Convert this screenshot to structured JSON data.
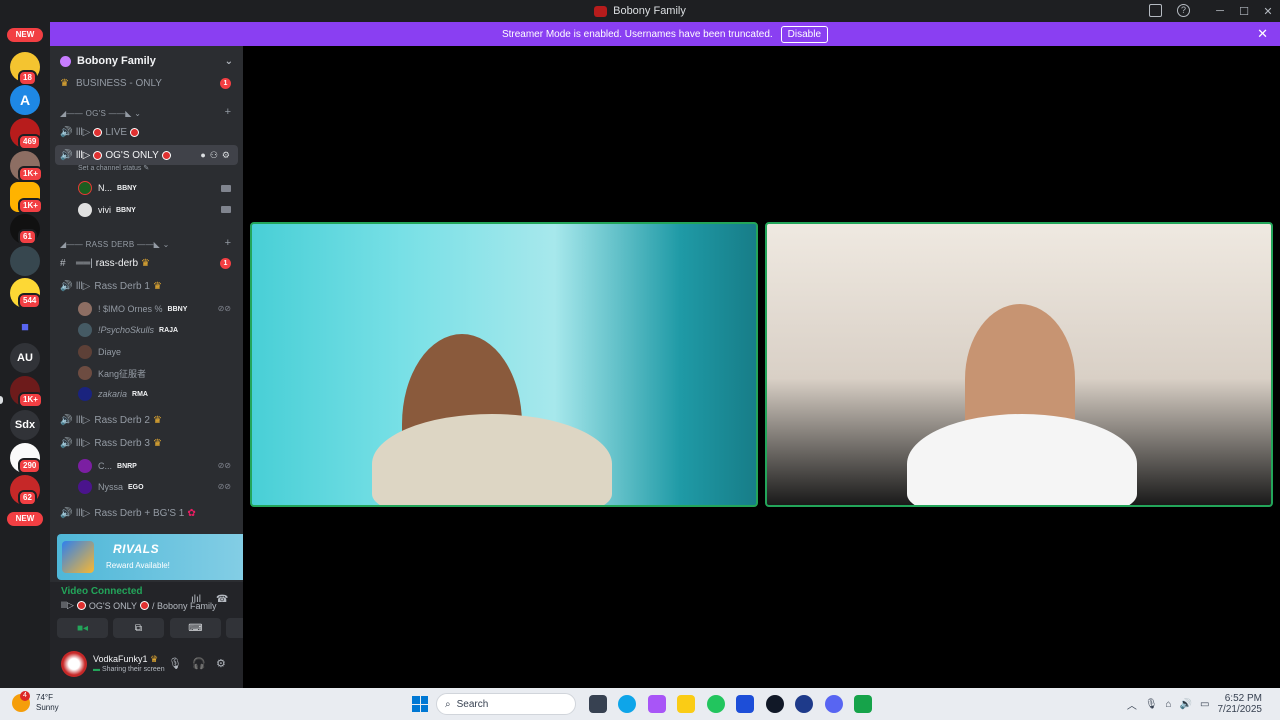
{
  "window": {
    "title": "Bobony Family"
  },
  "banner": {
    "text": "Streamer Mode is enabled. Usernames have been truncated.",
    "button": "Disable"
  },
  "servers": {
    "new_top": "NEW",
    "new_bottom": "NEW",
    "badges": [
      "18",
      "469",
      "1K+",
      "1K+",
      "61",
      "544",
      "1K+",
      "290",
      "62"
    ],
    "text_icons": [
      "AU",
      "Sdx"
    ]
  },
  "guild": {
    "name": "Bobony Family"
  },
  "channels": {
    "business": "BUSINESS - ONLY",
    "business_mentions": "1",
    "cat_ogs": "OG'S",
    "live": "LIVE",
    "ogs_only": "OG'S ONLY",
    "status_hint": "Set a channel status",
    "users_ogs": [
      {
        "name": "N...",
        "tag": "BBNY"
      },
      {
        "name": "vivi",
        "tag": "BBNY"
      }
    ],
    "cat_rass": "RASS DERB",
    "rass_text": "rass-derb",
    "rass_text_mentions": "1",
    "rass1": "Rass Derb 1",
    "users_rass1": [
      {
        "name": "! $IMO Ornes %",
        "tag": "BBNY"
      },
      {
        "name": "!PsychoSkulls",
        "tag": "RAJA"
      },
      {
        "name": "Diaye",
        "tag": ""
      },
      {
        "name": "Kang征服者",
        "tag": ""
      },
      {
        "name": "zakaria",
        "tag": "RMA"
      }
    ],
    "rass2": "Rass Derb 2",
    "rass3": "Rass Derb 3",
    "users_rass3": [
      {
        "name": "C...",
        "tag": "BNRP"
      },
      {
        "name": "Nyssa",
        "tag": "EGO"
      }
    ],
    "rass_bgs": "Rass Derb + BG'S 1"
  },
  "promo": {
    "logo": "RIVALS",
    "reward": "Reward Available!"
  },
  "voice": {
    "status": "Video Connected",
    "channel": "OG'S ONLY",
    "server": "/ Bobony Family"
  },
  "user": {
    "name": "VodkaFunky1",
    "status": "Sharing their screen"
  },
  "taskbar": {
    "temp": "74°F",
    "condition": "Sunny",
    "weather_badge": "4",
    "search": "Search",
    "time": "6:52 PM",
    "date": "7/21/2025"
  },
  "colors": {
    "accent": "#8a3ff2",
    "speaking_border": "#23a55a",
    "mention_red": "#f23f43"
  }
}
